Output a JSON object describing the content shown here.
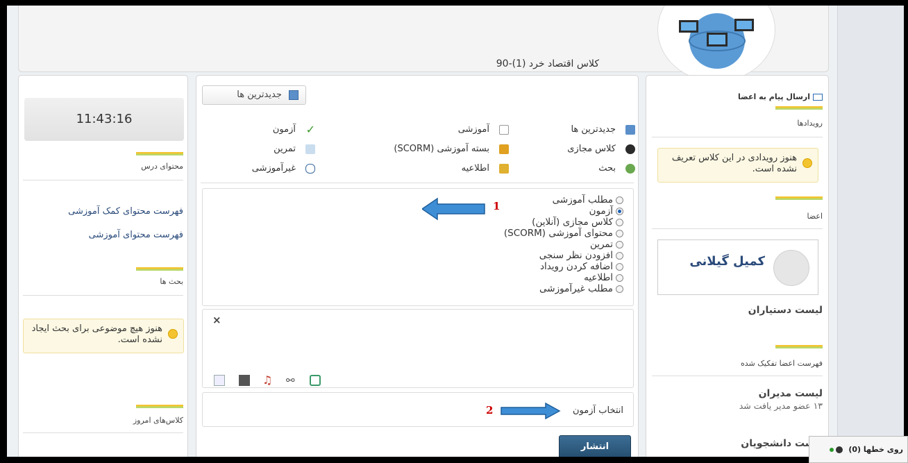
{
  "header": {
    "class_title": "کلاس اقتصاد خرد (1)-90"
  },
  "left_column": {
    "clock": "11:43:16",
    "content_label": "محتوای درس",
    "links": [
      "فهرست محتوای کمک آموزشی",
      "فهرست محتوای آموزشی"
    ],
    "discussions_label": "بحث ها",
    "discussions_notice": "هنوز هیچ موضوعی برای بحث ایجاد نشده است.",
    "today_classes_label": "کلاس‌های امروز"
  },
  "middle_column": {
    "newest_button": "جدیدترین ها",
    "categories": {
      "newest": "جدیدترین ها",
      "educational": "آموزشی",
      "exam": "آزمون",
      "virtual_class": "کلاس مجازی",
      "scorm_package": "بسته آموزشی (SCORM)",
      "exercise": "تمرین",
      "discussion": "بحث",
      "announcement": "اطلاعیه",
      "non_educational": "غیرآموزشی"
    },
    "radio_options": [
      "مطلب آموزشی",
      "آزمون",
      "کلاس مجازی (آنلاین)",
      "محتوای آموزشی (SCORM)",
      "تمرین",
      "افزودن نظر سنجی",
      "اضافه کردن رویداد",
      "اطلاعیه",
      "مطلب غیرآموزشی"
    ],
    "selected_option": "آزمون",
    "close_symbol": "×",
    "select_exam_text": "انتخاب آزمون",
    "publish_button": "انتشار",
    "annotation_1": "1",
    "annotation_2": "2"
  },
  "right_column": {
    "send_message": "ارسال پیام به اعضا",
    "events_label": "رویدادها",
    "events_notice": "هنوز رویدادی در این کلاس تعریف نشده است.",
    "members_label": "اعضا",
    "member_name": "کمیل گیلانی",
    "assistants_list": "لیست دستیاران",
    "separated_members": "فهرست اعضا تفکیک شده",
    "managers_list": "لیست مدیران",
    "managers_count_text": "۱۳ عضو مدیر یافت شد",
    "students_list": "لیست دانشجویان"
  },
  "chat_bar": {
    "label": "روی خطها (0)"
  },
  "colors": {
    "accent_blue": "#2a6ab0",
    "annotation_red": "#c00000",
    "publish_bg": "#2f5b80"
  }
}
